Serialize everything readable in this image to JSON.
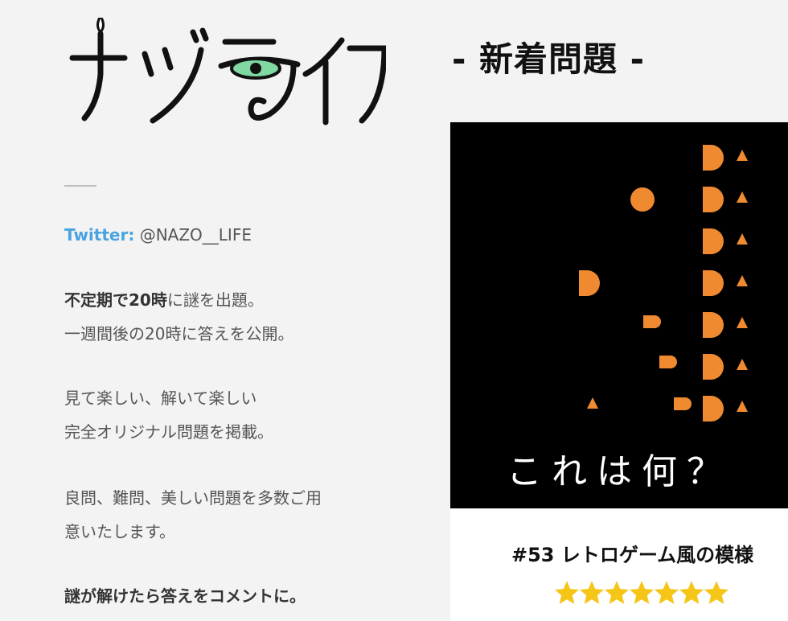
{
  "site": {
    "logo_text": "ナゾライフ"
  },
  "sidebar": {
    "twitter_label": "Twitter:",
    "twitter_handle": "@NAZO__LIFE",
    "para1_bold": "不定期で20時",
    "para1_rest": "に謎を出題。",
    "para1_line2": "一週間後の20時に答えを公開。",
    "para2_line1": "見て楽しい、解いて楽しい",
    "para2_line2": "完全オリジナル問題を掲載。",
    "para3_line1": "良問、難問、美しい問題を多数ご用",
    "para3_line2": "意いたします。",
    "para4": "謎が解けたら答えをコメントに。"
  },
  "main": {
    "section_title": "- 新着問題 -",
    "post": {
      "caption": "これは何？",
      "title": "#53 レトロゲーム風の模様",
      "rating": 7,
      "star_color": "#f5c518",
      "shape_color": "#f08a30"
    }
  }
}
